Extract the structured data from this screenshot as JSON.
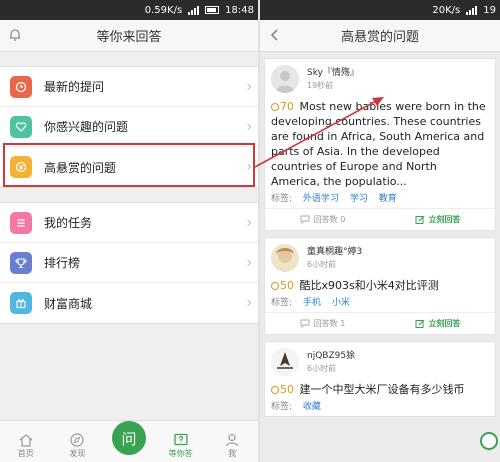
{
  "left": {
    "status": {
      "speed": "0.59K/s",
      "time": "18:48"
    },
    "title": "等你来回答",
    "menu_groups": [
      [
        {
          "label": "最新的提问",
          "icon": "clock-icon",
          "color": "#e9684a"
        },
        {
          "label": "你感兴趣的问题",
          "icon": "heart-icon",
          "color": "#4fc3a0"
        },
        {
          "label": "高悬赏的问题",
          "icon": "coin-icon",
          "color": "#f2b233"
        }
      ],
      [
        {
          "label": "我的任务",
          "icon": "task-icon",
          "color": "#f07aa5"
        },
        {
          "label": "排行榜",
          "icon": "trophy-icon",
          "color": "#6a7fd0"
        },
        {
          "label": "财富商城",
          "icon": "gift-icon",
          "color": "#52b7e0"
        }
      ]
    ],
    "nav": [
      {
        "label": "首页",
        "icon": "home-icon"
      },
      {
        "label": "发现",
        "icon": "compass-icon"
      },
      {
        "label": "问",
        "icon": "ask-icon"
      },
      {
        "label": "等你答",
        "icon": "answer-icon"
      },
      {
        "label": "我",
        "icon": "person-icon"
      }
    ],
    "colors": {
      "accent": "#3aa353",
      "highlight": "#cc3b3b"
    }
  },
  "right": {
    "status": {
      "speed": "20K/s",
      "time": "19"
    },
    "title": "高悬赏的问题",
    "cards": [
      {
        "user": "Sky『情殇』",
        "time": "19秒前",
        "reward": "70",
        "question": "Most new babies were born in the developing countries. These countries are found in Africa, South America and parts of Asia. In the developed countries of Europe and North America, the populatio...",
        "tags_label": "标签:",
        "tags": [
          "外语学习",
          "学习",
          "教育"
        ],
        "answers": "回答数 0",
        "answer_btn": "立刻回答"
      },
      {
        "user": "童真桐趣°婷3",
        "time": "6小时前",
        "reward": "50",
        "question": "酷比x903s和小米4对比评测",
        "tags_label": "标签:",
        "tags": [
          "手机",
          "小米"
        ],
        "answers": "回答数 1",
        "answer_btn": "立刻回答"
      },
      {
        "user": "njQBZ95狳",
        "time": "6小时前",
        "reward": "50",
        "question": "建一个中型大米厂设备有多少钱币",
        "tags_label": "标签:",
        "tags": [
          "收藏"
        ]
      }
    ]
  }
}
